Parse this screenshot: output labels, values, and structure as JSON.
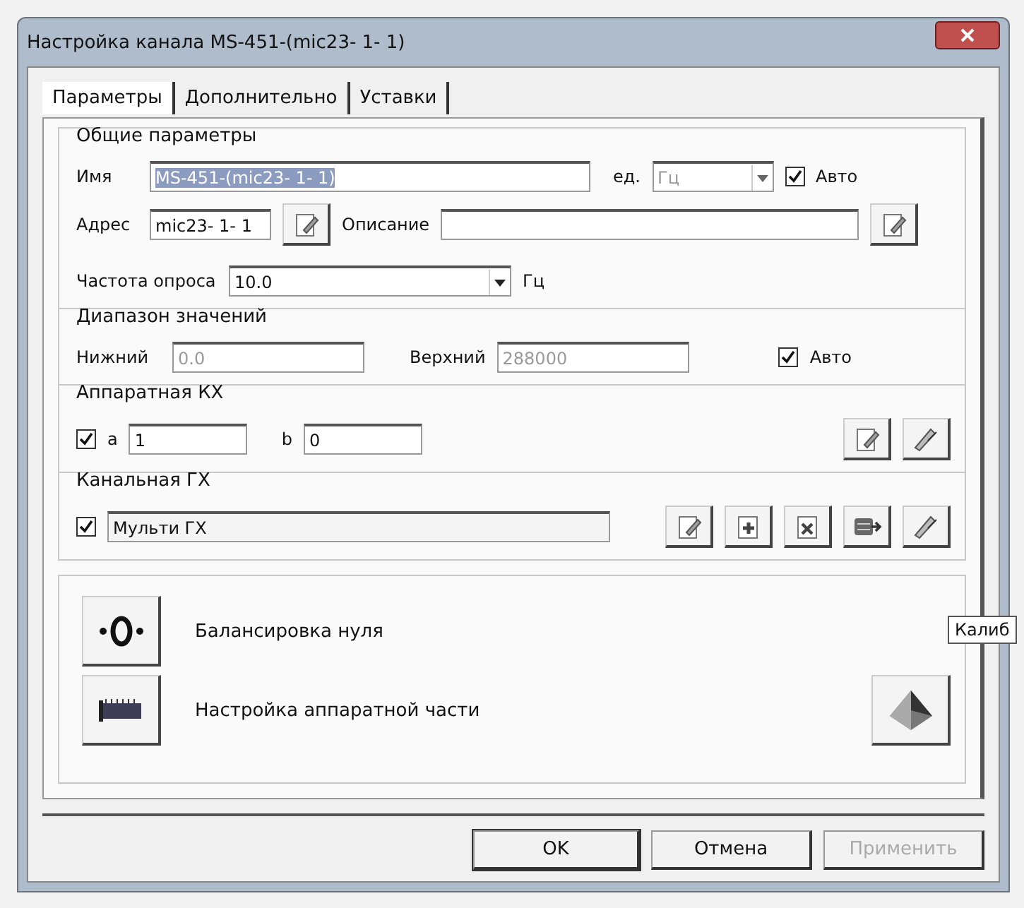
{
  "window": {
    "title": "Настройка канала MS-451-(mic23- 1- 1)"
  },
  "tabs": [
    {
      "label": "Параметры",
      "selected": true
    },
    {
      "label": "Дополнительно",
      "selected": false
    },
    {
      "label": "Уставки",
      "selected": false
    }
  ],
  "general": {
    "title": "Общие параметры",
    "name_label": "Имя",
    "name_value": "MS-451-(mic23- 1- 1)",
    "name_highlighted": true,
    "unit_label": "ед.",
    "unit_value": "Гц",
    "unit_disabled": true,
    "auto_label": "Авто",
    "auto_checked": true,
    "address_label": "Адрес",
    "address_value": "mic23- 1- 1",
    "description_label": "Описание",
    "rate_label": "Частота опроса",
    "rate_value": "10.0",
    "rate_unit": "Гц"
  },
  "range": {
    "title": "Диапазон значений",
    "lower_label": "Нижний",
    "lower_value": "0.0",
    "upper_label": "Верхний",
    "upper_value": "288000",
    "disabled": true,
    "auto_label": "Авто",
    "auto_checked": true
  },
  "hardware": {
    "title": "Аппаратная КХ",
    "checked": true,
    "a_label": "a",
    "a_value": "1",
    "b_label": "b",
    "b_value": "0"
  },
  "channel": {
    "title": "Канальная ГХ",
    "checked": true,
    "value": "Мульти ГХ"
  },
  "tooltip": "Калиб",
  "actions": [
    {
      "kind": "balance",
      "label": "Балансировка нуля"
    },
    {
      "kind": "hardware",
      "label": "Настройка аппаратной части"
    }
  ],
  "buttons": [
    {
      "label": "OK",
      "disabled": false,
      "default": true
    },
    {
      "label": "Отмена",
      "disabled": false,
      "default": false
    },
    {
      "label": "Применить",
      "disabled": true,
      "default": false
    }
  ]
}
